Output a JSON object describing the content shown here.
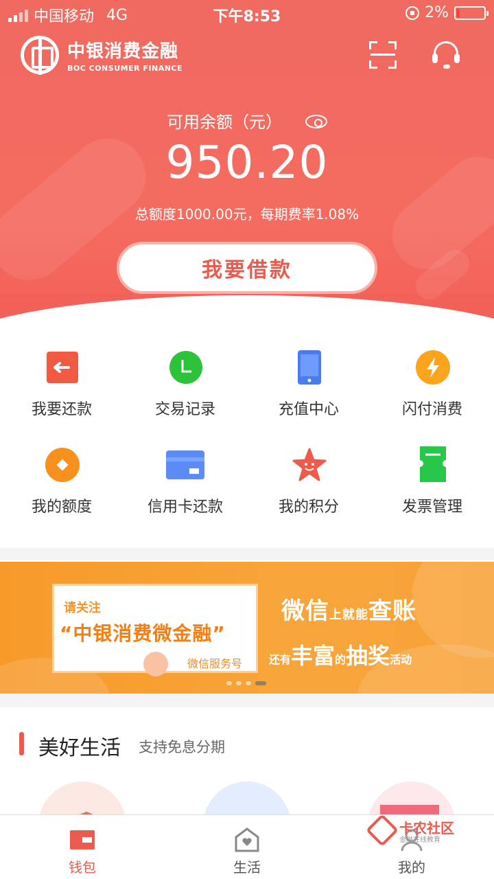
{
  "status_bar": {
    "carrier": "中国移动",
    "network": "4G",
    "time": "下午8:53",
    "battery": "2%"
  },
  "brand": {
    "name_cn": "中银消费金融",
    "name_en": "BOC CONSUMER FINANCE"
  },
  "header_icons": [
    "scan-icon",
    "customer-service-icon"
  ],
  "balance": {
    "label": "可用余额（元）",
    "amount": "950.20",
    "quota_text": "总额度1000.00元，每期费率1.08%",
    "borrow_button": "我要借款"
  },
  "colors": {
    "primary": "#f06a5f",
    "accent": "#ea5a4e",
    "banner": "#f79a2a"
  },
  "functions": [
    {
      "label": "我要还款",
      "icon": "repay-arrow-icon"
    },
    {
      "label": "交易记录",
      "icon": "clock-icon"
    },
    {
      "label": "充值中心",
      "icon": "phone-icon"
    },
    {
      "label": "闪付消费",
      "icon": "lightning-icon"
    },
    {
      "label": "我的额度",
      "icon": "diamond-coin-icon"
    },
    {
      "label": "信用卡还款",
      "icon": "credit-card-icon"
    },
    {
      "label": "我的积分",
      "icon": "star-icon"
    },
    {
      "label": "发票管理",
      "icon": "ticket-icon"
    }
  ],
  "banner": {
    "notice": "请关注",
    "account": "“中银消费微金融”",
    "service": "微信服务号",
    "line1_a": "微信",
    "line1_b": "上就能",
    "line1_c": "查账",
    "line2_a": "还有",
    "line2_b": "丰富",
    "line2_c": "的",
    "line2_d": "抽奖",
    "line2_e": "活动"
  },
  "section": {
    "title": "美好生活",
    "subtitle": "支持免息分期"
  },
  "tabs": [
    {
      "label": "钱包",
      "icon": "wallet-icon",
      "active": true
    },
    {
      "label": "生活",
      "icon": "life-home-icon",
      "active": false
    },
    {
      "label": "我的",
      "icon": "profile-icon",
      "active": false
    }
  ],
  "watermark": {
    "name": "卡农社区",
    "tagline": "金融在线教育"
  }
}
